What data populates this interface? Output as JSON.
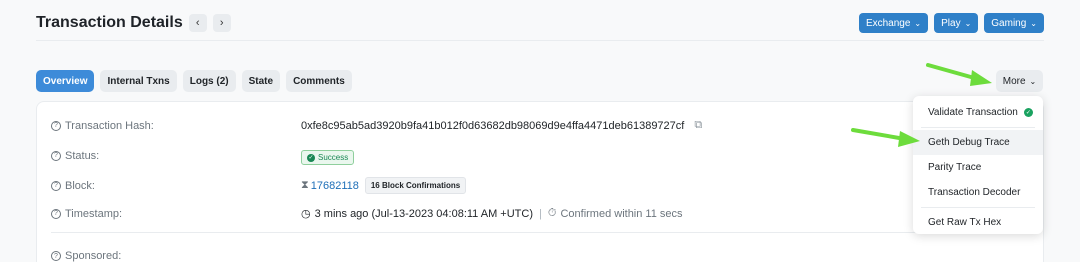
{
  "header": {
    "title": "Transaction Details",
    "prev_icon": "chevron-left-icon",
    "next_icon": "chevron-right-icon",
    "buttons": [
      "Exchange",
      "Play",
      "Gaming"
    ]
  },
  "tabs": [
    "Overview",
    "Internal Txns",
    "Logs (2)",
    "State",
    "Comments"
  ],
  "more_label": "More",
  "rows": {
    "hash": {
      "label": "Transaction Hash:",
      "value": "0xfe8c95ab5ad3920b9fa41b012f0d63682db98069d9e4ffa4471deb61389727cf"
    },
    "status": {
      "label": "Status:",
      "value": "Success"
    },
    "block": {
      "label": "Block:",
      "value": "17682118",
      "confirmations": "16 Block Confirmations"
    },
    "timestamp": {
      "label": "Timestamp:",
      "value": "3 mins ago (Jul-13-2023 04:08:11 AM +UTC)",
      "confirmed": "Confirmed within 11 secs"
    },
    "sponsored": {
      "label": "Sponsored:"
    }
  },
  "dropdown": {
    "items": [
      "Validate Transaction",
      "Geth Debug Trace",
      "Parity Trace",
      "Transaction Decoder",
      "Get Raw Tx Hex"
    ]
  },
  "colors": {
    "accent": "#2f80c8",
    "success": "#198754",
    "arrow": "#6ddc3c"
  }
}
